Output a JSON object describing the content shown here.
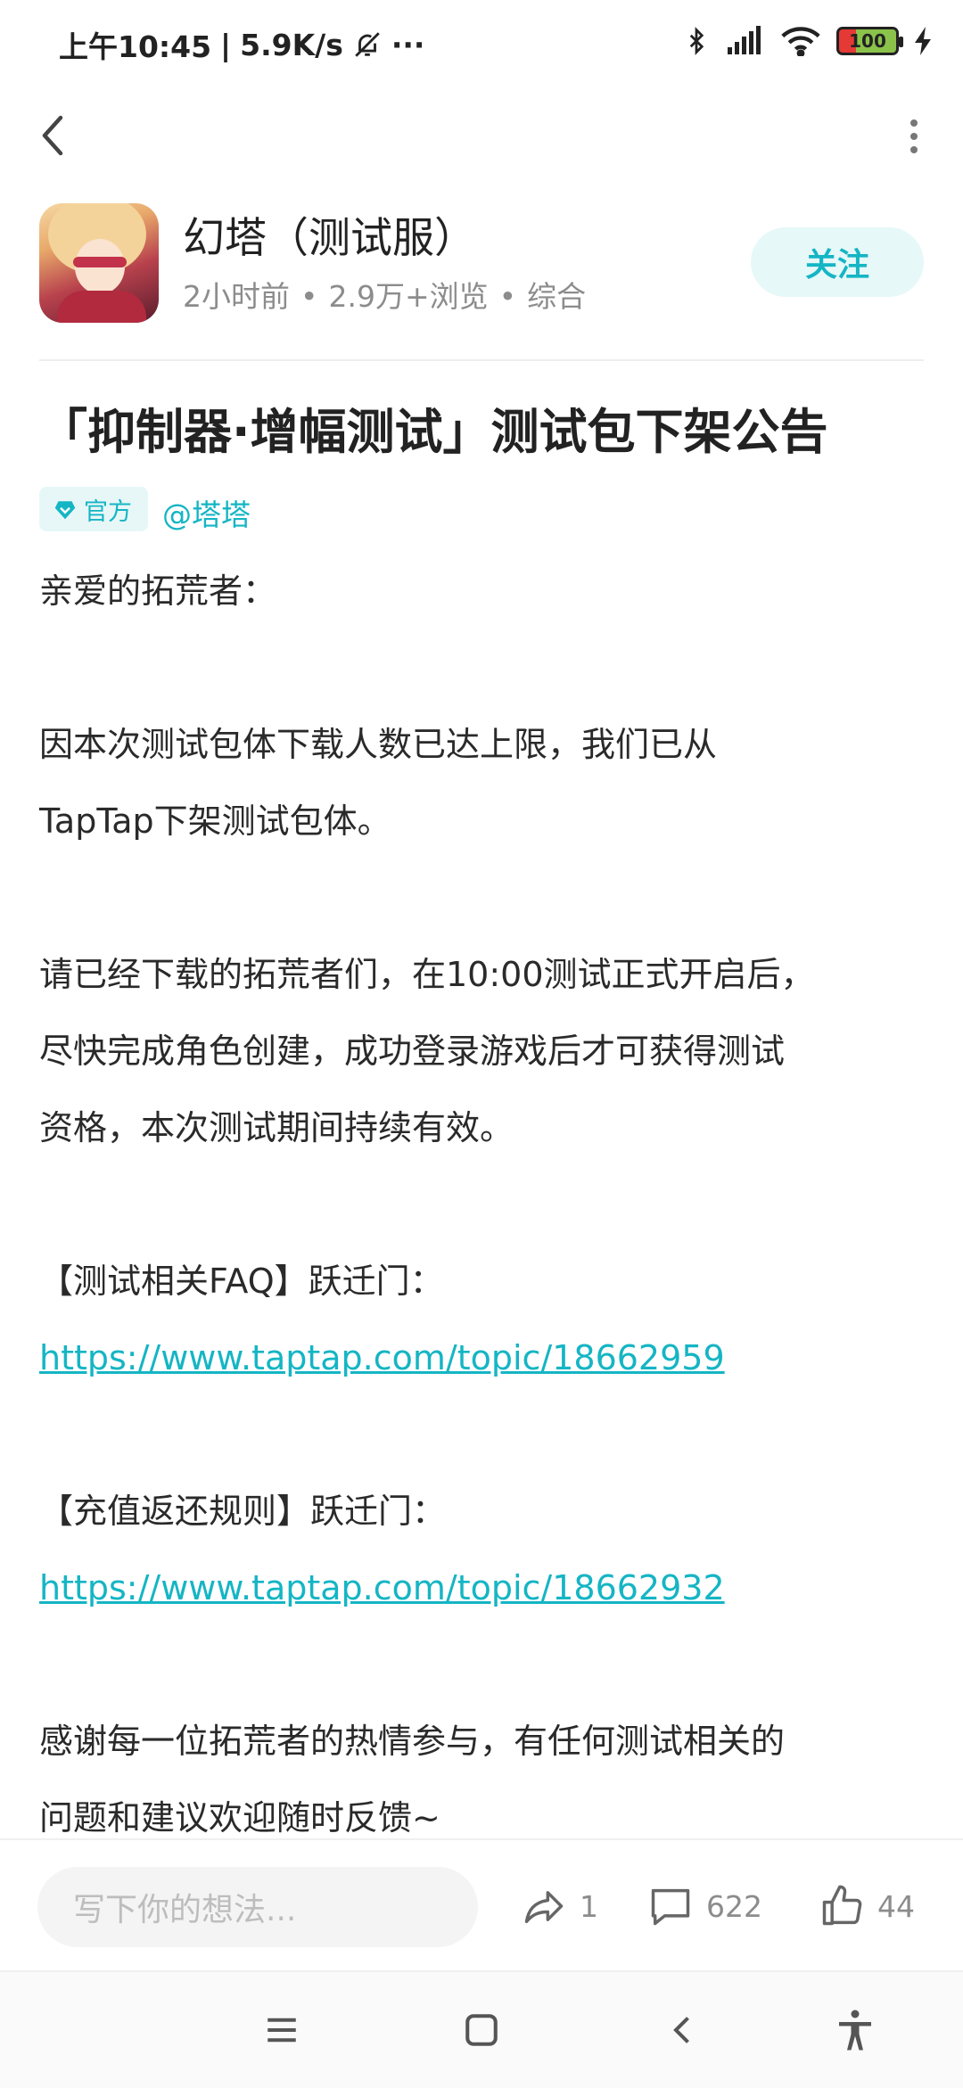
{
  "status_bar": {
    "time": "上午10:45",
    "separator": "|",
    "net_speed": "5.9K/s",
    "more": "···",
    "battery": "100",
    "icons": [
      "mute-bell-icon",
      "bluetooth-icon",
      "signal-icon",
      "wifi-icon",
      "battery-icon",
      "charging-icon"
    ]
  },
  "nav": {
    "back_icon": "back-arrow-icon",
    "more_icon": "more-vertical-icon"
  },
  "post_header": {
    "game_name": "幻塔（测试服）",
    "time_ago": "2小时前",
    "views": "2.9万+浏览",
    "category": "综合",
    "dot": "•",
    "follow_label": "关注"
  },
  "article": {
    "title": "「抑制器·增幅测试」测试包下架公告",
    "official_label": "官方",
    "author": "@塔塔",
    "lines": [
      {
        "text": "亲爱的拓荒者：",
        "link": false
      },
      {
        "text": "",
        "link": false
      },
      {
        "text": "因本次测试包体下载人数已达上限，我们已从",
        "link": false
      },
      {
        "text": "TapTap下架测试包体。",
        "link": false
      },
      {
        "text": "",
        "link": false
      },
      {
        "text": "请已经下载的拓荒者们，在10:00测试正式开启后，",
        "link": false
      },
      {
        "text": "尽快完成角色创建，成功登录游戏后才可获得测试",
        "link": false
      },
      {
        "text": "资格，本次测试期间持续有效。",
        "link": false
      },
      {
        "text": "",
        "link": false
      },
      {
        "text": "【测试相关FAQ】跃迁门：",
        "link": false
      },
      {
        "text": "https://www.taptap.com/topic/18662959",
        "link": true
      },
      {
        "text": "",
        "link": false
      },
      {
        "text": "【充值返还规则】跃迁门：",
        "link": false
      },
      {
        "text": "https://www.taptap.com/topic/18662932",
        "link": true
      },
      {
        "text": "",
        "link": false
      },
      {
        "text": "感谢每一位拓荒者的热情参与，有任何测试相关的",
        "link": false
      },
      {
        "text": "问题和建议欢迎随时反馈~",
        "link": false
      }
    ]
  },
  "bottom_bar": {
    "comment_placeholder": "写下你的想法...",
    "share_count": "1",
    "comment_count": "622",
    "like_count": "44"
  },
  "colors": {
    "accent": "#15b5c4",
    "follow_bg": "#e6f8f8",
    "meta_gray": "#8c8c8c"
  }
}
